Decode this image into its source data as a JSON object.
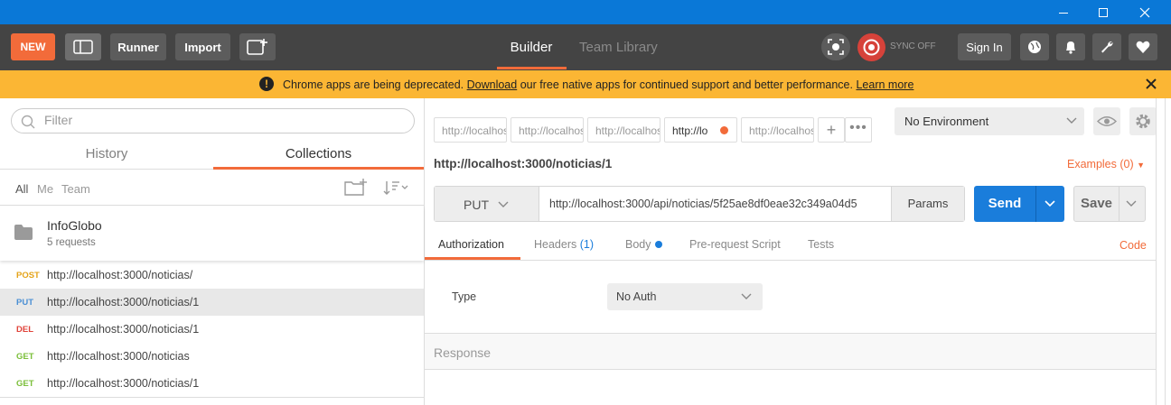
{
  "header": {
    "new_label": "NEW",
    "runner_label": "Runner",
    "import_label": "Import",
    "builder_label": "Builder",
    "team_library_label": "Team Library",
    "sync_label": "SYNC OFF",
    "signin_label": "Sign In"
  },
  "banner": {
    "prefix": "Chrome apps are being deprecated.",
    "download_link": "Download",
    "middle": "our free native apps for continued support and better performance.",
    "learn_more_link": "Learn more"
  },
  "sidebar": {
    "filter_placeholder": "Filter",
    "tab_history": "History",
    "tab_collections": "Collections",
    "filters": [
      "All",
      "Me",
      "Team"
    ],
    "collection": {
      "name": "InfoGlobo",
      "count": "5 requests"
    },
    "requests": [
      {
        "method": "POST",
        "url": "http://localhost:3000/noticias/",
        "color": "#e4a319"
      },
      {
        "method": "PUT",
        "url": "http://localhost:3000/noticias/1",
        "color": "#4a8fd4"
      },
      {
        "method": "DEL",
        "url": "http://localhost:3000/noticias/1",
        "color": "#e0433a"
      },
      {
        "method": "GET",
        "url": "http://localhost:3000/noticias",
        "color": "#7bbf3a"
      },
      {
        "method": "GET",
        "url": "http://localhost:3000/noticias/1",
        "color": "#7bbf3a"
      }
    ]
  },
  "tabs": [
    "http://localhost",
    "http://localhost",
    "http://localhost",
    "http://lo",
    "http://localhost"
  ],
  "environment": "No Environment",
  "request": {
    "title": "http://localhost:3000/noticias/1",
    "examples_label": "Examples (0)",
    "method": "PUT",
    "url": "http://localhost:3000/api/noticias/5f25ae8df0eae32c349a04d5",
    "params_label": "Params",
    "send_label": "Send",
    "save_label": "Save",
    "tab_authorization": "Authorization",
    "tab_headers": "Headers",
    "tab_headers_count": "(1)",
    "tab_body": "Body",
    "tab_prerequest": "Pre-request Script",
    "tab_tests": "Tests",
    "code_label": "Code",
    "type_label": "Type",
    "auth_value": "No Auth",
    "response_label": "Response"
  },
  "colors": {
    "accent": "#f26b3a",
    "send_blue": "#1a7ddb",
    "banner": "#fbb634",
    "header": "#444444"
  }
}
